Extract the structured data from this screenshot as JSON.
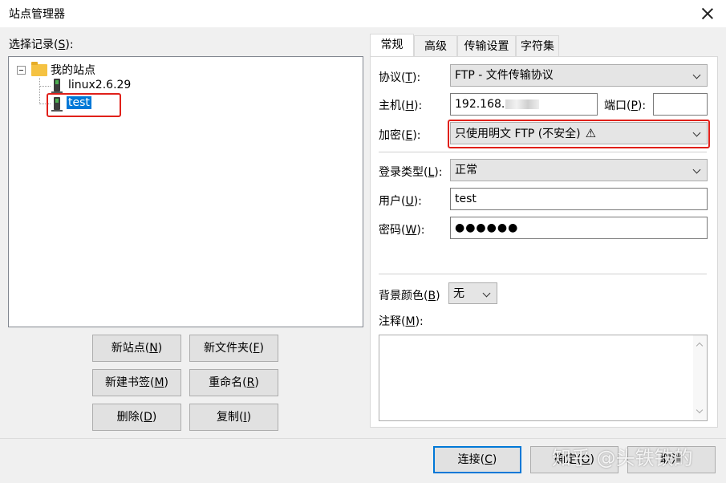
{
  "window": {
    "title": "站点管理器"
  },
  "left": {
    "select_label": "选择记录(",
    "select_key": "S",
    "select_suffix": "):",
    "tree": {
      "root": "我的站点",
      "items": [
        {
          "label": "linux2.6.29"
        },
        {
          "label": "test",
          "selected": true
        }
      ]
    },
    "buttons": {
      "new_site": {
        "text": "新站点(",
        "key": "N"
      },
      "new_folder": {
        "text": "新文件夹(",
        "key": "F"
      },
      "new_bookmark": {
        "text": "新建书签(",
        "key": "M"
      },
      "rename": {
        "text": "重命名(",
        "key": "R"
      },
      "delete": {
        "text": "删除(",
        "key": "D"
      },
      "copy": {
        "text": "复制(",
        "key": "I"
      }
    }
  },
  "tabs": [
    "常规",
    "高级",
    "传输设置",
    "字符集"
  ],
  "general": {
    "protocol": {
      "label": "协议(",
      "key": "T",
      "value": "FTP - 文件传输协议"
    },
    "host": {
      "label": "主机(",
      "key": "H",
      "value": "192.168."
    },
    "port": {
      "label": "端口(",
      "key": "P",
      "value": ""
    },
    "encryption": {
      "label": "加密(",
      "key": "E",
      "value": "只使用明文 FTP (不安全)"
    },
    "login_type": {
      "label": "登录类型(",
      "key": "L",
      "value": "正常"
    },
    "user": {
      "label": "用户(",
      "key": "U",
      "value": "test"
    },
    "password": {
      "label": "密码(",
      "key": "W",
      "value": "●●●●●●"
    },
    "bg_color": {
      "label": "背景颜色(",
      "key": "B",
      "value": "无"
    },
    "comments": {
      "label": "注释(",
      "key": "M",
      "value": ""
    }
  },
  "footer": {
    "connect": {
      "text": "连接(",
      "key": "C"
    },
    "ok": {
      "text": "确定(",
      "key": "O"
    },
    "cancel": {
      "text": "取消"
    }
  },
  "watermark": "知乎 @头铁铁的",
  "colors": {
    "selection": "#0078d7",
    "highlight": "#e0201a",
    "focus": "#0078d7"
  }
}
